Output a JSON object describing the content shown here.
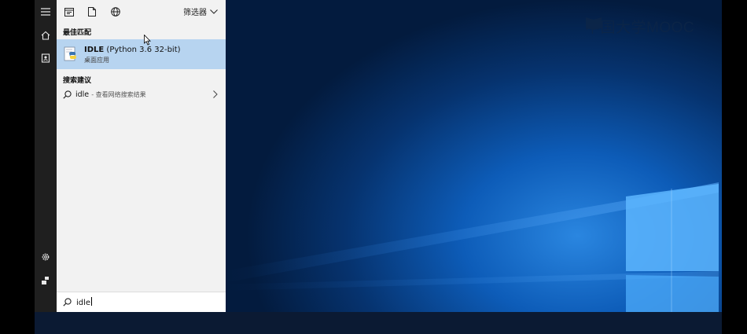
{
  "toolbar": {
    "filter_label": "筛选器"
  },
  "sections": {
    "best_match": "最佳匹配",
    "search_suggestions": "搜索建议"
  },
  "best_match": {
    "app_name": "IDLE",
    "app_detail": "(Python 3.6 32-bit)",
    "app_type": "桌面应用"
  },
  "suggestion": {
    "query": "idle",
    "hint": "- 查看网络搜索结果"
  },
  "search": {
    "value": "idle"
  },
  "watermark": {
    "text": "中国大学MOOC"
  },
  "rail_icons": [
    "menu-icon",
    "home-icon",
    "contacts-icon",
    "settings-icon",
    "user-icon"
  ],
  "toolbar_icons": [
    "app-window-icon",
    "document-icon",
    "globe-icon"
  ],
  "colors": {
    "selected_bg": "#b7d4f0",
    "panel_bg": "#f2f2f2",
    "rail_bg": "#1f1f1f",
    "desktop_accent": "#2a86e0"
  }
}
